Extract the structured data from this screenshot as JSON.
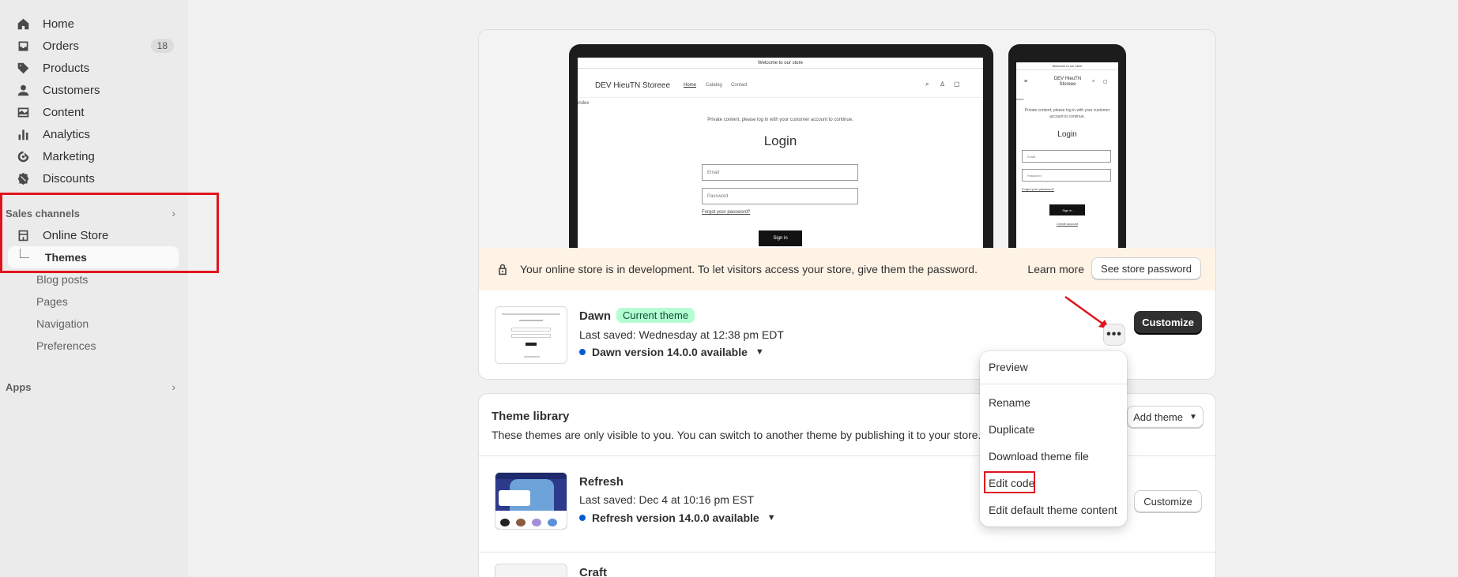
{
  "sidebar": {
    "home": "Home",
    "orders": "Orders",
    "orders_count": "18",
    "products": "Products",
    "customers": "Customers",
    "content": "Content",
    "analytics": "Analytics",
    "marketing": "Marketing",
    "discounts": "Discounts",
    "sales_channels": "Sales channels",
    "online_store": "Online Store",
    "themes": "Themes",
    "blog_posts": "Blog posts",
    "pages": "Pages",
    "navigation": "Navigation",
    "preferences": "Preferences",
    "apps": "Apps"
  },
  "preview": {
    "announcement": "Welcome to our store",
    "store_name": "DEV HieuTN Storeee",
    "nav_home": "Home",
    "nav_catalog": "Catalog",
    "nav_contact": "Contact",
    "index_label": "index",
    "private_msg": "Private content, please log in with your customer account to continue.",
    "login_title": "Login",
    "email_ph": "Email",
    "password_ph": "Password",
    "forgot": "Forgot your password?",
    "sign_in": "Sign in",
    "create_account": "Create account",
    "phone_store_name_1": "DEV HieuTN",
    "phone_store_name_2": "Storeee"
  },
  "banner": {
    "message": "Your online store is in development. To let visitors access your store, give them the password.",
    "learn_more": "Learn more",
    "see_password": "See store password"
  },
  "current_theme": {
    "name": "Dawn",
    "badge": "Current theme",
    "last_saved": "Last saved: Wednesday at 12:38 pm EDT",
    "version": "Dawn version 14.0.0 available",
    "more_label": "•••",
    "customize": "Customize"
  },
  "menu": {
    "preview": "Preview",
    "rename": "Rename",
    "duplicate": "Duplicate",
    "download": "Download theme file",
    "edit_code": "Edit code",
    "edit_default": "Edit default theme content"
  },
  "library": {
    "title": "Theme library",
    "description": "These themes are only visible to you. You can switch to another theme by publishing it to your store.",
    "add_theme": "Add theme",
    "themes": [
      {
        "name": "Refresh",
        "last_saved": "Last saved: Dec 4 at 10:16 pm EST",
        "version": "Refresh version 14.0.0 available",
        "customize": "Customize"
      },
      {
        "name": "Craft"
      }
    ]
  },
  "colors": {
    "annotation_red": "#e0141e",
    "banner_bg": "#fff3e6",
    "badge_green": "#b4fed2",
    "dot_blue": "#005bd3"
  }
}
